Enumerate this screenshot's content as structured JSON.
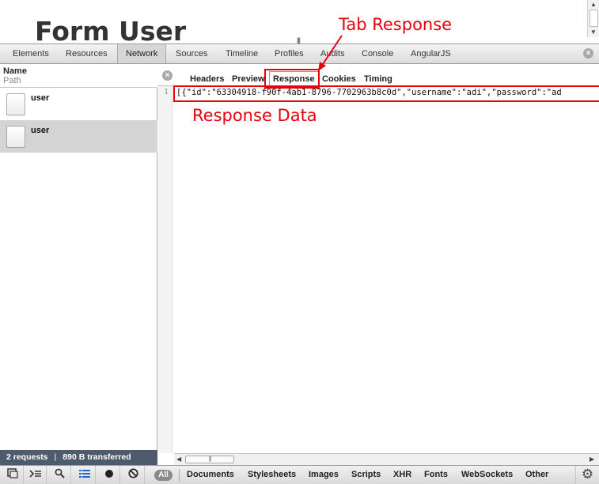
{
  "page": {
    "title": "Form User"
  },
  "devtools": {
    "tabs": [
      "Elements",
      "Resources",
      "Network",
      "Sources",
      "Timeline",
      "Profiles",
      "Audits",
      "Console",
      "AngularJS"
    ],
    "active_tab": "Network"
  },
  "requests": {
    "header_name": "Name",
    "header_path": "Path",
    "items": [
      {
        "name": "user",
        "selected": false
      },
      {
        "name": "user",
        "selected": true
      }
    ],
    "summary_count": "2 requests",
    "summary_separator": "|",
    "summary_transferred": "890 B transferred"
  },
  "detail": {
    "tabs": [
      "Headers",
      "Preview",
      "Response",
      "Cookies",
      "Timing"
    ],
    "active_tab": "Response",
    "line_number": "1",
    "response_text": "[{\"id\":\"63304918-f90f-4ab1-8796-7702963b8c0d\",\"username\":\"adi\",\"password\":\"ad"
  },
  "toolbar": {
    "filter_all": "All",
    "filters": [
      "Documents",
      "Stylesheets",
      "Images",
      "Scripts",
      "XHR",
      "Fonts",
      "WebSockets",
      "Other"
    ]
  },
  "annotations": {
    "tab_response": "Tab Response",
    "response_data": "Response Data",
    "color": "#e8000b"
  },
  "colors": {
    "status_bar": "#4e5b6c",
    "selected_row": "#d4d4d4"
  }
}
